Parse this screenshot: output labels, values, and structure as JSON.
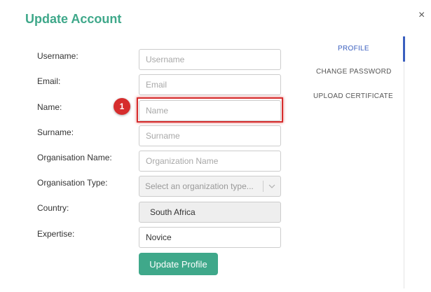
{
  "modal": {
    "title": "Update Account",
    "close_glyph": "×"
  },
  "form": {
    "username": {
      "label": "Username:",
      "placeholder": "Username",
      "value": ""
    },
    "email": {
      "label": "Email:",
      "placeholder": "Email",
      "value": ""
    },
    "name": {
      "label": "Name:",
      "placeholder": "Name",
      "value": ""
    },
    "surname": {
      "label": "Surname:",
      "placeholder": "Surname",
      "value": ""
    },
    "organisation_name": {
      "label": "Organisation Name:",
      "placeholder": "Organization Name",
      "value": ""
    },
    "organisation_type": {
      "label": "Organisation Type:",
      "placeholder": "Select an organization type..."
    },
    "country": {
      "label": "Country:",
      "value": "South Africa"
    },
    "expertise": {
      "label": "Expertise:",
      "value": "Novice"
    },
    "submit_label": "Update Profile"
  },
  "annotation": {
    "step": "1"
  },
  "tabs": [
    {
      "label": "PROFILE",
      "active": true
    },
    {
      "label": "CHANGE PASSWORD",
      "active": false
    },
    {
      "label": "UPLOAD CERTIFICATE",
      "active": false
    }
  ],
  "colors": {
    "accent": "#3fa88a",
    "active_tab": "#3a5fbf",
    "highlight": "#d62d2d"
  }
}
